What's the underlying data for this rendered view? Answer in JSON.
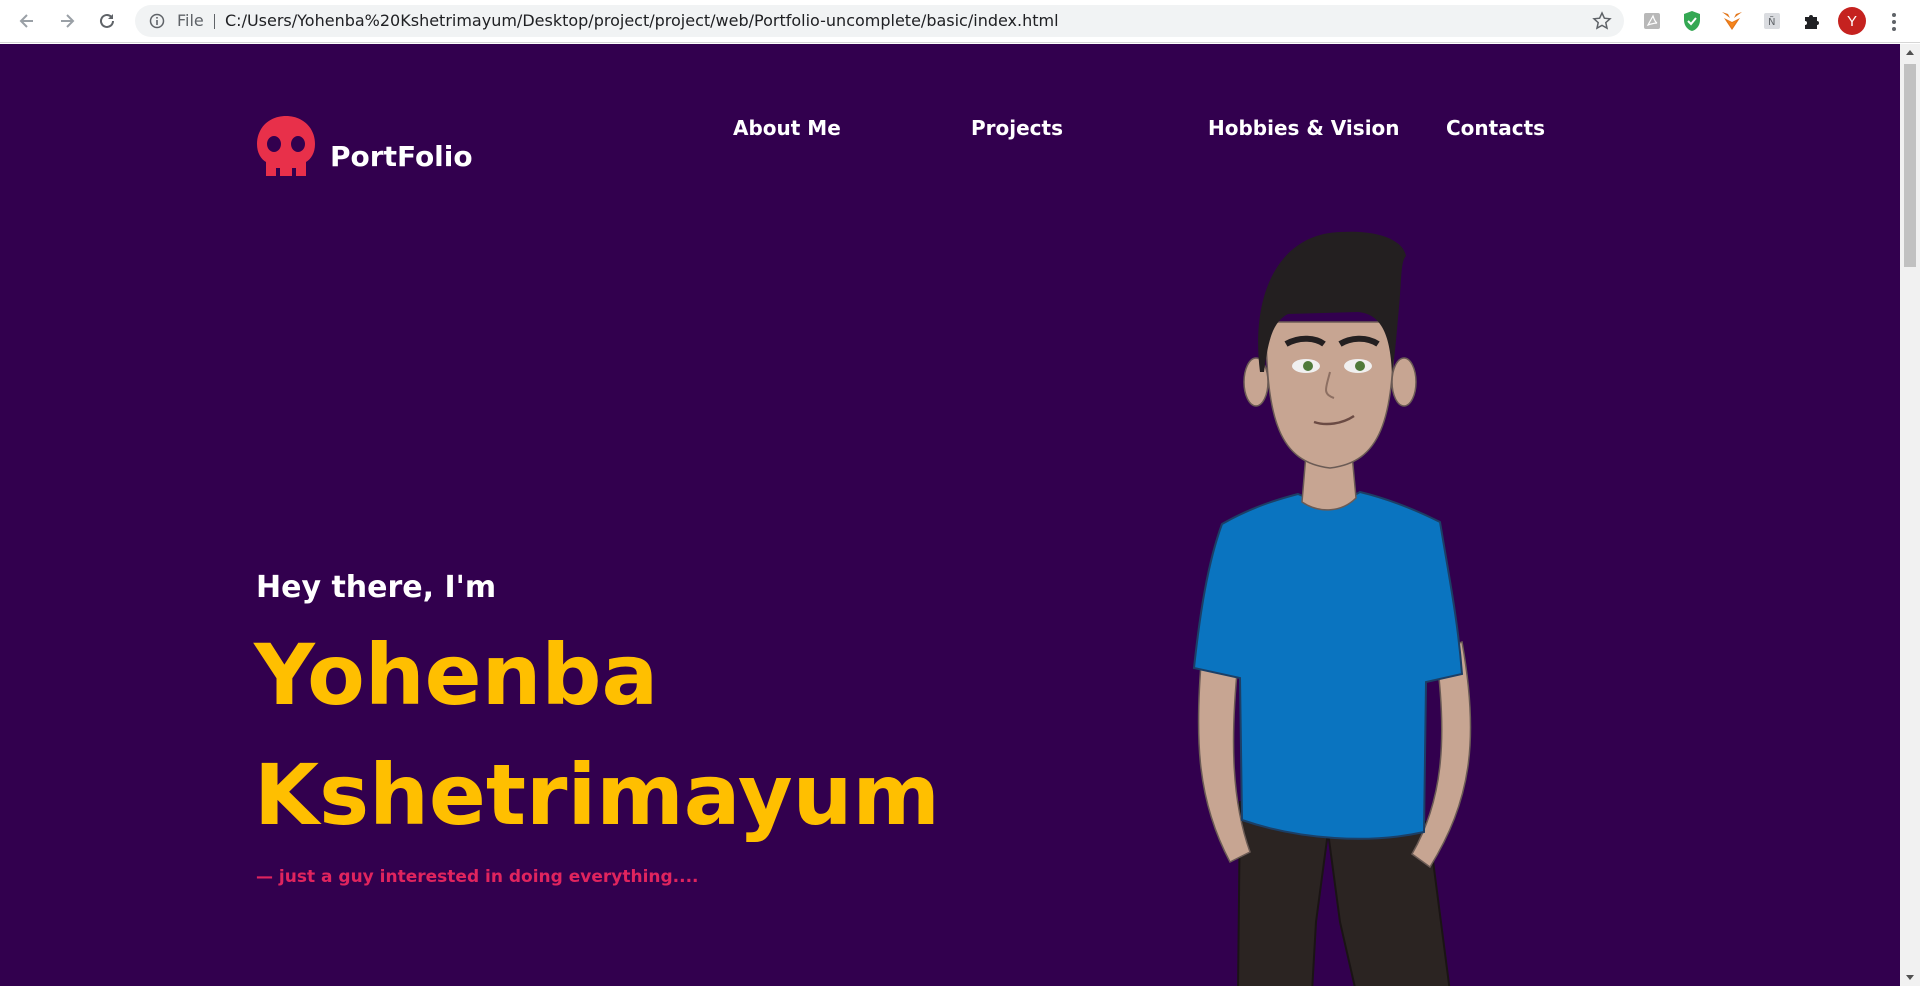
{
  "browser": {
    "scheme_label": "File",
    "url": "C:/Users/Yohenba%20Kshetrimayum/Desktop/project/project/web/Portfolio-uncomplete/basic/index.html",
    "profile_initial": "Y",
    "extensions": [
      "pdf-extension-icon",
      "shield-extension-icon",
      "metamask-fox-icon",
      "translate-extension-icon",
      "puzzle-extensions-icon"
    ]
  },
  "site": {
    "logo_text": "PortFolio",
    "nav": [
      "About Me",
      "Projects",
      "Hobbies & Vision",
      "Contacts"
    ]
  },
  "hero": {
    "greeting": "Hey there, I'm",
    "first_name": "Yohenba",
    "last_name": "Kshetrimayum",
    "tagline": "— just a guy interested in doing everything...."
  },
  "colors": {
    "background": "#32004e",
    "accent_yellow": "#ffbf00",
    "accent_red": "#e0245e",
    "logo_red": "#e8304a"
  }
}
